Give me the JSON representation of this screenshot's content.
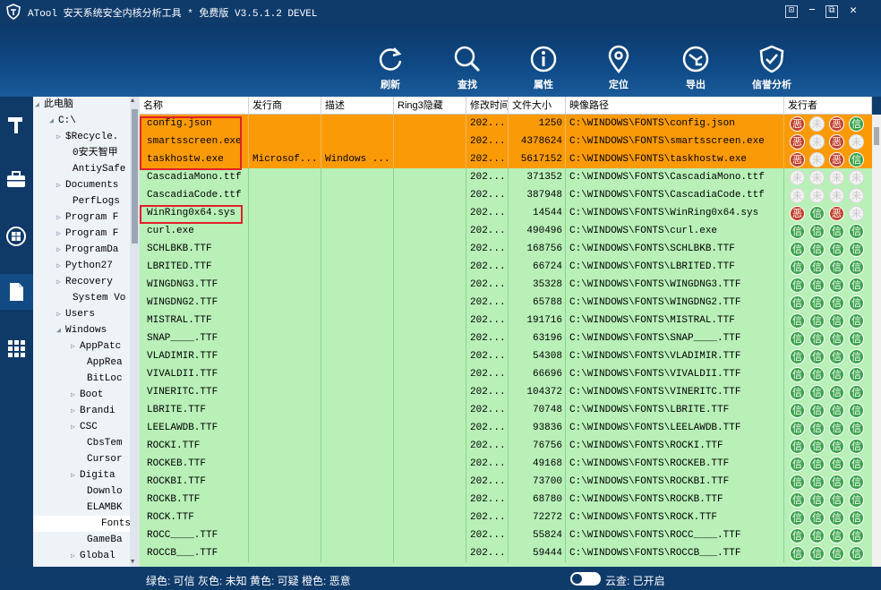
{
  "app": {
    "title": "ATool 安天系统安全内核分析工具 * 免费版 V3.5.1.2 DEVEL",
    "window_buttons": [
      "⊡",
      "—",
      "⧉",
      "✕"
    ]
  },
  "toolbar": {
    "refresh": "刷新",
    "search": "查找",
    "properties": "属性",
    "locate": "定位",
    "export": "导出",
    "reputation": "信誉分析"
  },
  "tree": {
    "nodes": [
      {
        "label": "此电脑",
        "arrow": "◢"
      },
      {
        "label": "C:\\",
        "arrow": "◢"
      },
      {
        "label": "$Recycle.",
        "arrow": "▷"
      },
      {
        "label": "0安天智甲",
        "arrow": ""
      },
      {
        "label": "AntiySafe",
        "arrow": ""
      },
      {
        "label": "Documents",
        "arrow": "▷"
      },
      {
        "label": "PerfLogs",
        "arrow": ""
      },
      {
        "label": "Program F",
        "arrow": "▷"
      },
      {
        "label": "Program F",
        "arrow": "▷"
      },
      {
        "label": "ProgramDa",
        "arrow": "▷"
      },
      {
        "label": "Python27",
        "arrow": "▷"
      },
      {
        "label": "Recovery",
        "arrow": "▷"
      },
      {
        "label": "System Vo",
        "arrow": ""
      },
      {
        "label": "Users",
        "arrow": "▷"
      },
      {
        "label": "Windows",
        "arrow": "◢"
      },
      {
        "label": "AppPatc",
        "arrow": "▷"
      },
      {
        "label": "AppRea",
        "arrow": ""
      },
      {
        "label": "BitLoc",
        "arrow": ""
      },
      {
        "label": "Boot",
        "arrow": "▷"
      },
      {
        "label": "Brandi",
        "arrow": "▷"
      },
      {
        "label": "CSC",
        "arrow": "▷"
      },
      {
        "label": "CbsTem",
        "arrow": ""
      },
      {
        "label": "Cursor",
        "arrow": ""
      },
      {
        "label": "Digita",
        "arrow": "▷"
      },
      {
        "label": "Downlo",
        "arrow": ""
      },
      {
        "label": "ELAMBK",
        "arrow": ""
      },
      {
        "label": "Fonts",
        "arrow": ""
      },
      {
        "label": "GameBa",
        "arrow": ""
      },
      {
        "label": "Global",
        "arrow": "▷"
      }
    ]
  },
  "grid": {
    "columns": [
      "名称",
      "发行商",
      "描述",
      "Ring3隐藏",
      "修改时间",
      "文件大小",
      "映像路径",
      "发行者"
    ],
    "rows": [
      {
        "name": "config.json",
        "publisher": "",
        "desc": "",
        "time": "202...",
        "size": "1250",
        "path": "C:\\WINDOWS\\FONTS\\config.json",
        "color": "orange",
        "badges": [
          "r",
          "w",
          "r",
          "g"
        ]
      },
      {
        "name": "smartsscreen.exe",
        "publisher": "",
        "desc": "",
        "time": "202...",
        "size": "4378624",
        "path": "C:\\WINDOWS\\FONTS\\smartsscreen.exe",
        "color": "orange",
        "badges": [
          "r",
          "w",
          "r",
          "w"
        ]
      },
      {
        "name": "taskhostw.exe",
        "publisher": "Microsof...",
        "desc": "Windows ...",
        "time": "202...",
        "size": "5617152",
        "path": "C:\\WINDOWS\\FONTS\\taskhostw.exe",
        "color": "orange",
        "badges": [
          "r",
          "w",
          "r",
          "g"
        ]
      },
      {
        "name": "CascadiaMono.ttf",
        "publisher": "",
        "desc": "",
        "time": "202...",
        "size": "371352",
        "path": "C:\\WINDOWS\\FONTS\\CascadiaMono.ttf",
        "color": "green",
        "badges": [
          "w",
          "w",
          "w",
          "w"
        ]
      },
      {
        "name": "CascadiaCode.ttf",
        "publisher": "",
        "desc": "",
        "time": "202...",
        "size": "387948",
        "path": "C:\\WINDOWS\\FONTS\\CascadiaCode.ttf",
        "color": "green",
        "badges": [
          "w",
          "w",
          "w",
          "w"
        ]
      },
      {
        "name": "WinRing0x64.sys",
        "publisher": "",
        "desc": "",
        "time": "202...",
        "size": "14544",
        "path": "C:\\WINDOWS\\FONTS\\WinRing0x64.sys",
        "color": "green",
        "badges": [
          "r",
          "g",
          "r",
          "w"
        ]
      },
      {
        "name": "curl.exe",
        "publisher": "",
        "desc": "",
        "time": "202...",
        "size": "490496",
        "path": "C:\\WINDOWS\\FONTS\\curl.exe",
        "color": "green",
        "badges": [
          "g",
          "g",
          "g",
          "g"
        ]
      },
      {
        "name": "SCHLBKB.TTF",
        "publisher": "",
        "desc": "",
        "time": "202...",
        "size": "168756",
        "path": "C:\\WINDOWS\\FONTS\\SCHLBKB.TTF",
        "color": "green",
        "badges": [
          "g",
          "g",
          "g",
          "g"
        ]
      },
      {
        "name": "LBRITED.TTF",
        "publisher": "",
        "desc": "",
        "time": "202...",
        "size": "66724",
        "path": "C:\\WINDOWS\\FONTS\\LBRITED.TTF",
        "color": "green",
        "badges": [
          "g",
          "g",
          "g",
          "g"
        ]
      },
      {
        "name": "WINGDNG3.TTF",
        "publisher": "",
        "desc": "",
        "time": "202...",
        "size": "35328",
        "path": "C:\\WINDOWS\\FONTS\\WINGDNG3.TTF",
        "color": "green",
        "badges": [
          "g",
          "g",
          "g",
          "g"
        ]
      },
      {
        "name": "WINGDNG2.TTF",
        "publisher": "",
        "desc": "",
        "time": "202...",
        "size": "65788",
        "path": "C:\\WINDOWS\\FONTS\\WINGDNG2.TTF",
        "color": "green",
        "badges": [
          "g",
          "g",
          "g",
          "g"
        ]
      },
      {
        "name": "MISTRAL.TTF",
        "publisher": "",
        "desc": "",
        "time": "202...",
        "size": "191716",
        "path": "C:\\WINDOWS\\FONTS\\MISTRAL.TTF",
        "color": "green",
        "badges": [
          "g",
          "g",
          "g",
          "g"
        ]
      },
      {
        "name": "SNAP____.TTF",
        "publisher": "",
        "desc": "",
        "time": "202...",
        "size": "63196",
        "path": "C:\\WINDOWS\\FONTS\\SNAP____.TTF",
        "color": "green",
        "badges": [
          "g",
          "g",
          "g",
          "g"
        ]
      },
      {
        "name": "VLADIMIR.TTF",
        "publisher": "",
        "desc": "",
        "time": "202...",
        "size": "54308",
        "path": "C:\\WINDOWS\\FONTS\\VLADIMIR.TTF",
        "color": "green",
        "badges": [
          "g",
          "g",
          "g",
          "g"
        ]
      },
      {
        "name": "VIVALDII.TTF",
        "publisher": "",
        "desc": "",
        "time": "202...",
        "size": "66696",
        "path": "C:\\WINDOWS\\FONTS\\VIVALDII.TTF",
        "color": "green",
        "badges": [
          "g",
          "g",
          "g",
          "g"
        ]
      },
      {
        "name": "VINERITC.TTF",
        "publisher": "",
        "desc": "",
        "time": "202...",
        "size": "104372",
        "path": "C:\\WINDOWS\\FONTS\\VINERITC.TTF",
        "color": "green",
        "badges": [
          "g",
          "g",
          "g",
          "g"
        ]
      },
      {
        "name": "LBRITE.TTF",
        "publisher": "",
        "desc": "",
        "time": "202...",
        "size": "70748",
        "path": "C:\\WINDOWS\\FONTS\\LBRITE.TTF",
        "color": "green",
        "badges": [
          "g",
          "g",
          "g",
          "g"
        ]
      },
      {
        "name": "LEELAWDB.TTF",
        "publisher": "",
        "desc": "",
        "time": "202...",
        "size": "93836",
        "path": "C:\\WINDOWS\\FONTS\\LEELAWDB.TTF",
        "color": "green",
        "badges": [
          "g",
          "g",
          "g",
          "g"
        ]
      },
      {
        "name": "ROCKI.TTF",
        "publisher": "",
        "desc": "",
        "time": "202...",
        "size": "76756",
        "path": "C:\\WINDOWS\\FONTS\\ROCKI.TTF",
        "color": "green",
        "badges": [
          "g",
          "g",
          "g",
          "g"
        ]
      },
      {
        "name": "ROCKEB.TTF",
        "publisher": "",
        "desc": "",
        "time": "202...",
        "size": "49168",
        "path": "C:\\WINDOWS\\FONTS\\ROCKEB.TTF",
        "color": "green",
        "badges": [
          "g",
          "g",
          "g",
          "g"
        ]
      },
      {
        "name": "ROCKBI.TTF",
        "publisher": "",
        "desc": "",
        "time": "202...",
        "size": "73700",
        "path": "C:\\WINDOWS\\FONTS\\ROCKBI.TTF",
        "color": "green",
        "badges": [
          "g",
          "g",
          "g",
          "g"
        ]
      },
      {
        "name": "ROCKB.TTF",
        "publisher": "",
        "desc": "",
        "time": "202...",
        "size": "68780",
        "path": "C:\\WINDOWS\\FONTS\\ROCKB.TTF",
        "color": "green",
        "badges": [
          "g",
          "g",
          "g",
          "g"
        ]
      },
      {
        "name": "ROCK.TTF",
        "publisher": "",
        "desc": "",
        "time": "202...",
        "size": "72272",
        "path": "C:\\WINDOWS\\FONTS\\ROCK.TTF",
        "color": "green",
        "badges": [
          "g",
          "g",
          "g",
          "g"
        ]
      },
      {
        "name": "ROCC____.TTF",
        "publisher": "",
        "desc": "",
        "time": "202...",
        "size": "55824",
        "path": "C:\\WINDOWS\\FONTS\\ROCC____.TTF",
        "color": "green",
        "badges": [
          "g",
          "g",
          "g",
          "g"
        ]
      },
      {
        "name": "ROCCB___.TTF",
        "publisher": "",
        "desc": "",
        "time": "202...",
        "size": "59444",
        "path": "C:\\WINDOWS\\FONTS\\ROCCB___.TTF",
        "color": "green",
        "badges": [
          "g",
          "g",
          "g",
          "g"
        ]
      }
    ],
    "badge_glyphs": {
      "r": "恶",
      "g": "信",
      "y": "疑",
      "w": "未"
    }
  },
  "status": {
    "legend": "绿色: 可信  灰色: 未知  黄色: 可疑  橙色: 恶意",
    "cloud": "云查: 已开启"
  },
  "colors": {
    "malicious": "#fb9a07",
    "trusted": "#b8f0b8",
    "highlight": "#e0202a",
    "brand": "#0f3b6b"
  }
}
